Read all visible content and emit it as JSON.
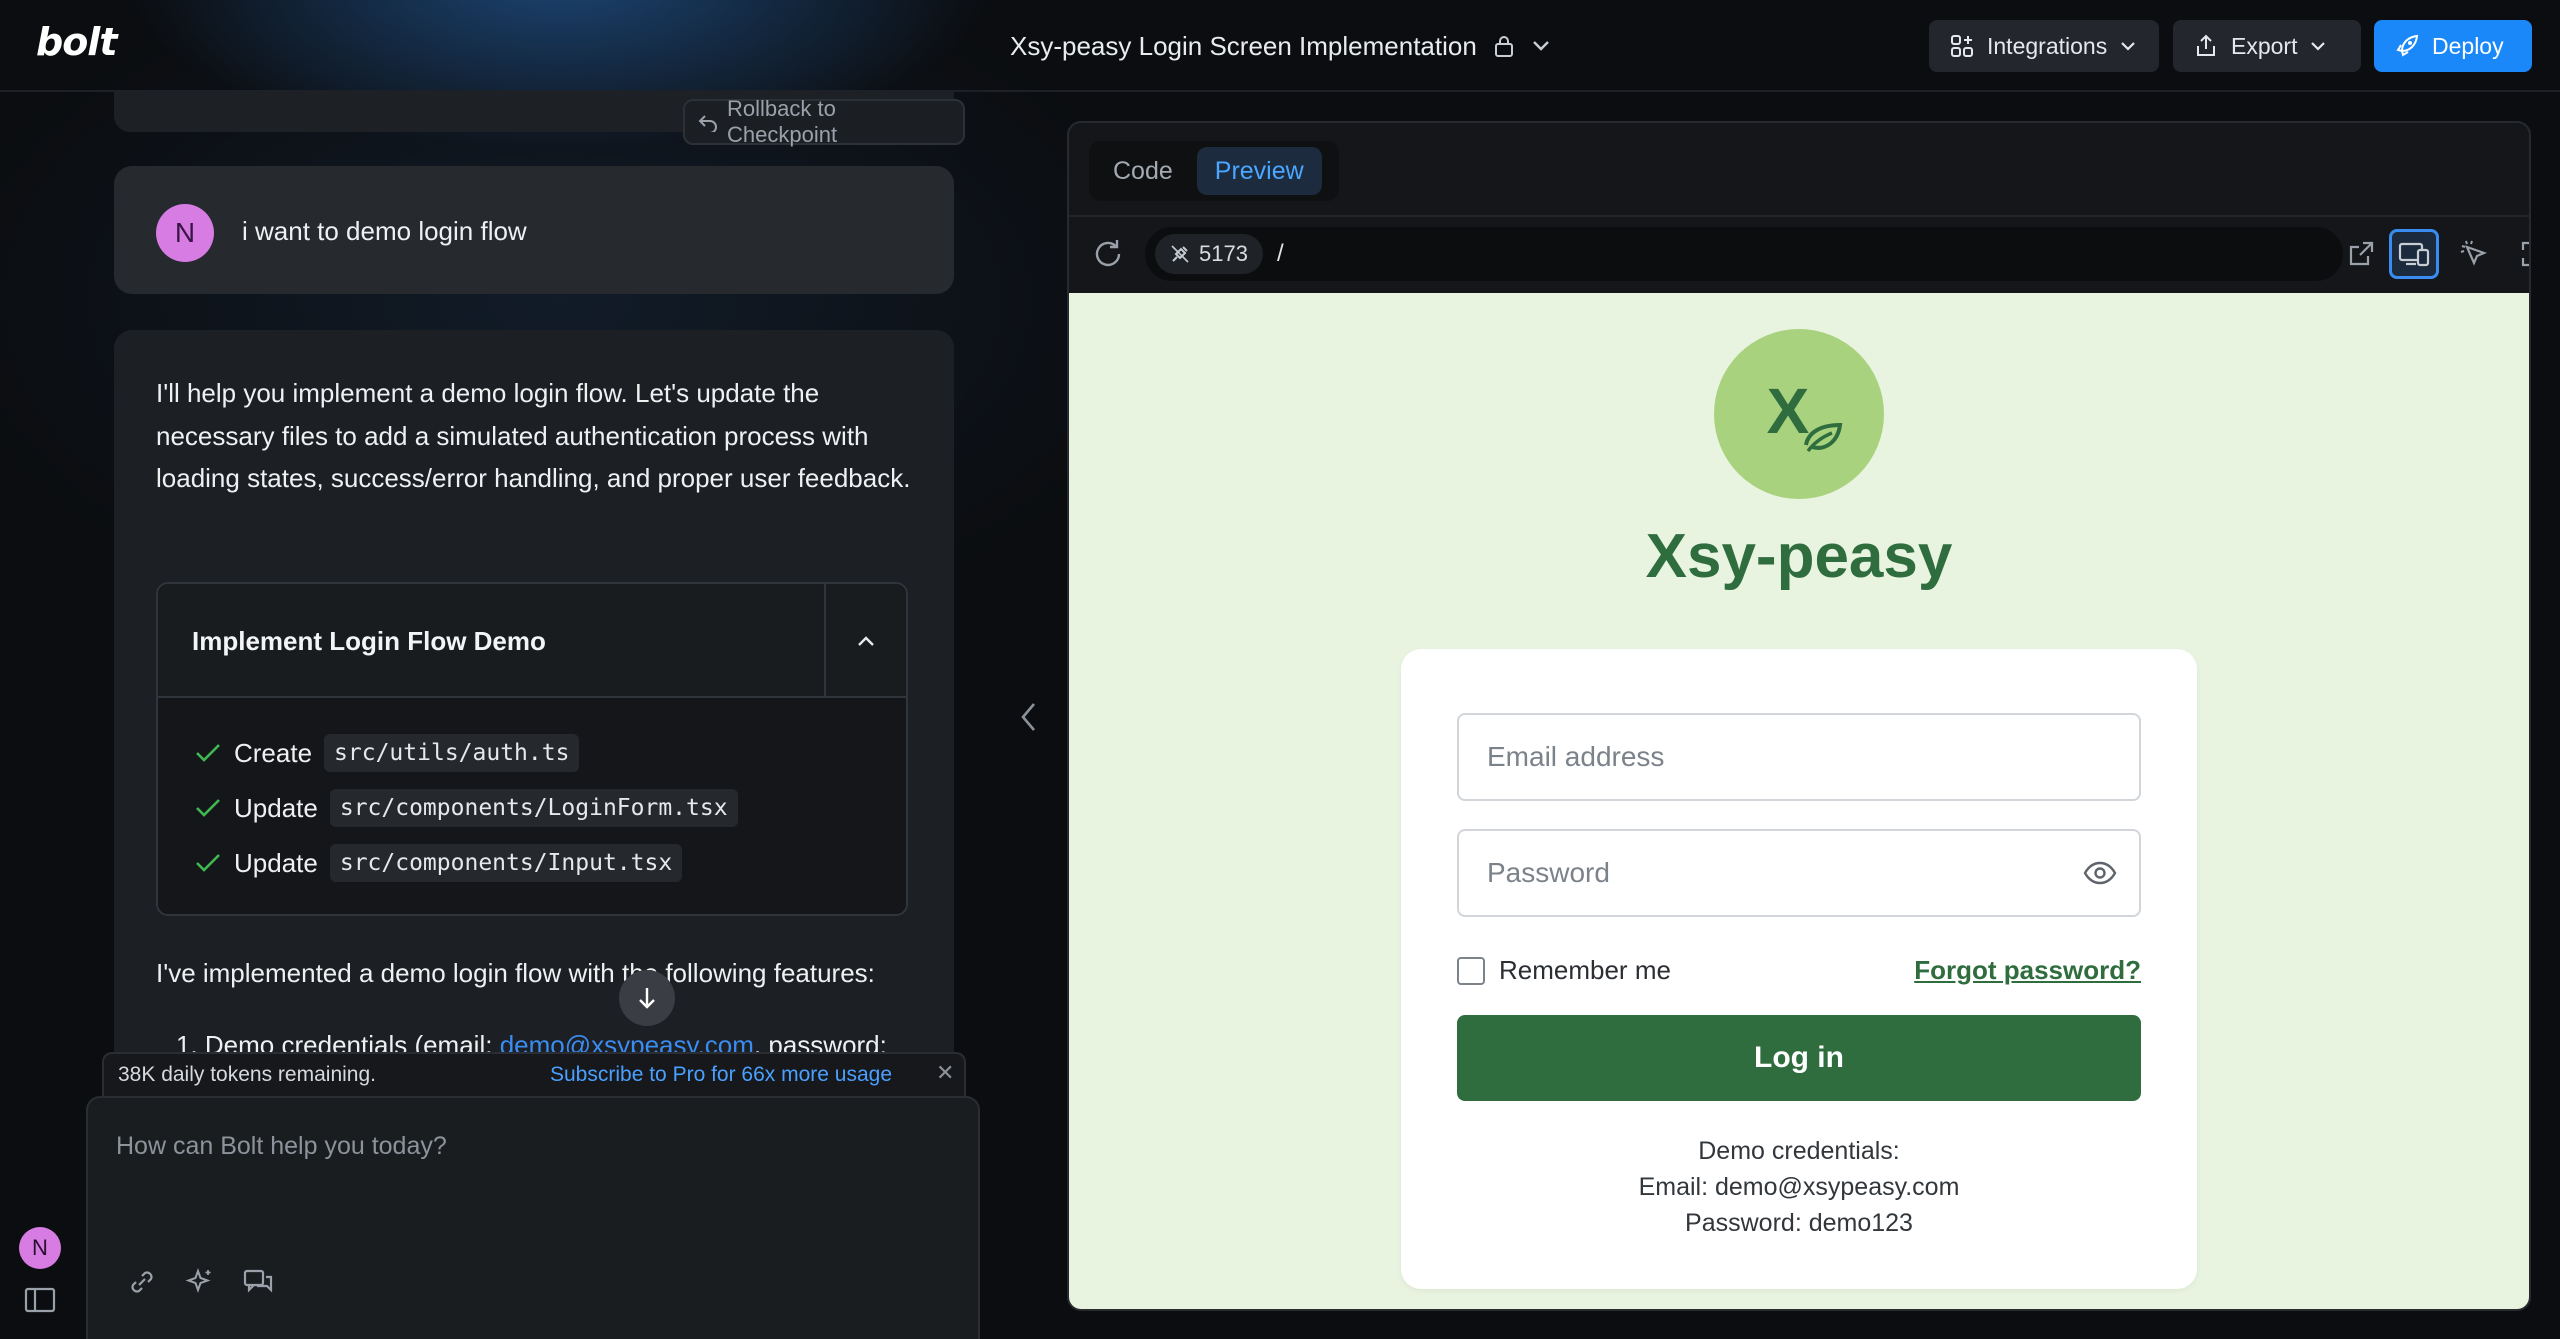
{
  "app": {
    "logo": "bolt",
    "project_title": "Xsy-peasy Login Screen Implementation"
  },
  "header": {
    "integrations_label": "Integrations",
    "export_label": "Export",
    "deploy_label": "Deploy"
  },
  "rail": {
    "avatar_initial": "N"
  },
  "chat": {
    "rollback_label": "Rollback to Checkpoint",
    "user_message": {
      "avatar_initial": "N",
      "text": "i want to demo login flow"
    },
    "assistant": {
      "intro": "I'll help you implement a demo login flow. Let's update the necessary files to add a simulated authentication process with loading states, success/error handling, and proper user feedback.",
      "artifact": {
        "title": "Implement Login Flow Demo",
        "steps": [
          {
            "action": "Create",
            "file": "src/utils/auth.ts"
          },
          {
            "action": "Update",
            "file": "src/components/LoginForm.tsx"
          },
          {
            "action": "Update",
            "file": "src/components/Input.tsx"
          }
        ]
      },
      "summary": "I've implemented a demo login flow with the following features:",
      "list_item_prefix": "1. Demo credentials (email: ",
      "list_item_link": "demo@xsypeasy.com",
      "list_item_suffix": ", password:"
    },
    "token_bar": {
      "remaining": "38K daily tokens remaining.",
      "upsell": "Subscribe to Pro for 66x more usage"
    },
    "composer": {
      "placeholder": "How can Bolt help you today?"
    }
  },
  "preview_panel": {
    "tabs": [
      {
        "label": "Code"
      },
      {
        "label": "Preview"
      }
    ],
    "active_tab": "Preview",
    "port": "5173",
    "path": "/"
  },
  "app_preview": {
    "brand_mark": "X",
    "brand_name": "Xsy-peasy",
    "email_placeholder": "Email address",
    "password_placeholder": "Password",
    "remember_label": "Remember me",
    "remember_checked": false,
    "forgot_label": "Forgot password?",
    "login_label": "Log in",
    "demo_heading": "Demo credentials:",
    "demo_email": "Email: demo@xsypeasy.com",
    "demo_password": "Password: demo123"
  },
  "colors": {
    "accent_blue": "#1a88f8",
    "brand_green": "#2f6d3f",
    "brand_circle": "#a8d27d",
    "preview_bg": "#e8f4e0",
    "avatar_pink": "#d67ce3"
  }
}
